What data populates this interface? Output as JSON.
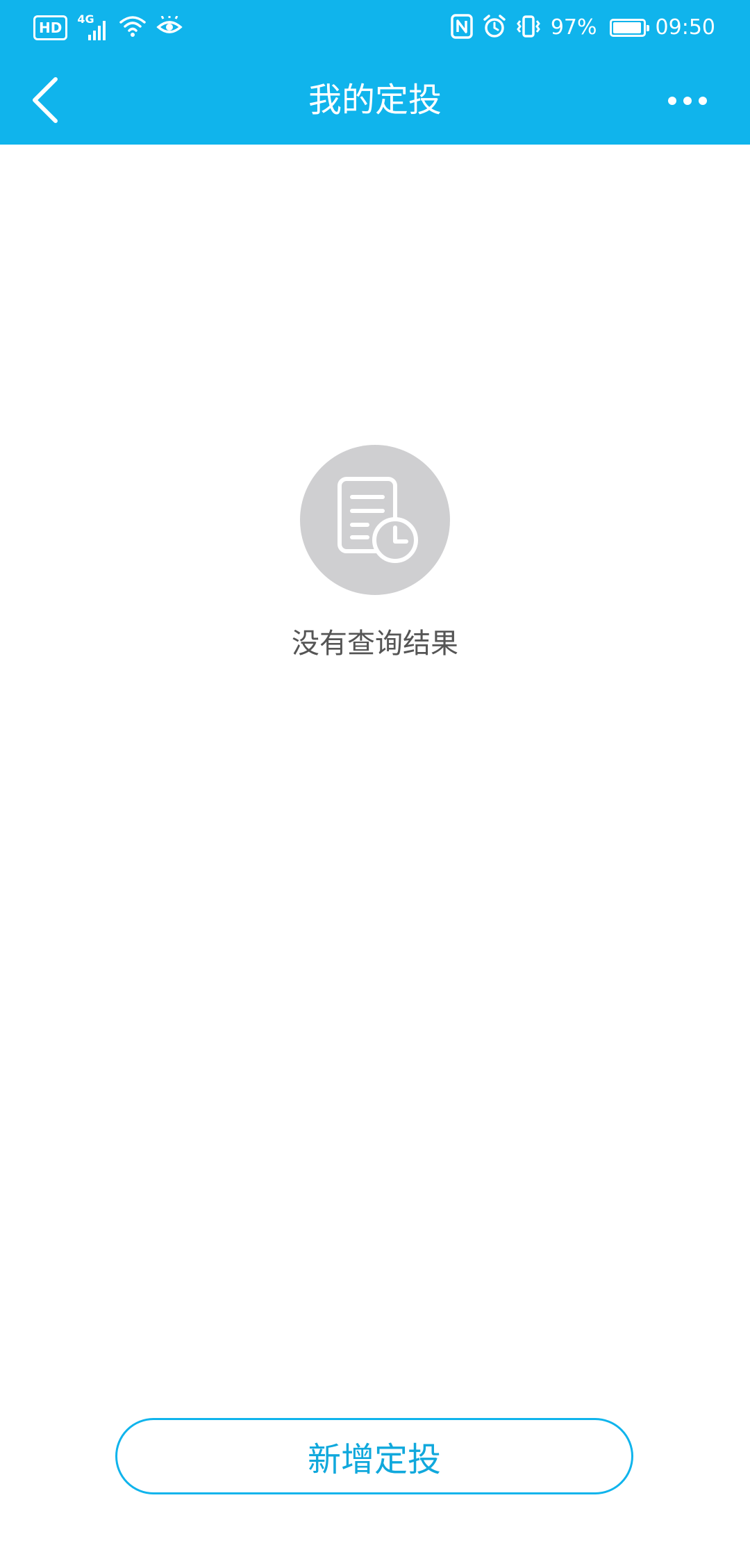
{
  "status_bar": {
    "hd_label": "HD",
    "network_label": "4G",
    "battery_text": "97%",
    "battery_level": 0.97,
    "time": "09:50"
  },
  "header": {
    "title": "我的定投",
    "back_icon": "chevron-left-icon",
    "more_icon": "more-dots-icon"
  },
  "empty_state": {
    "icon": "document-clock-icon",
    "message": "没有查询结果"
  },
  "footer": {
    "add_button_label": "新增定投"
  },
  "colors": {
    "brand_blue": "#10b4ec",
    "empty_icon_bg": "#cfcfd1",
    "empty_text": "#555555",
    "button_text": "#10a8dc"
  }
}
